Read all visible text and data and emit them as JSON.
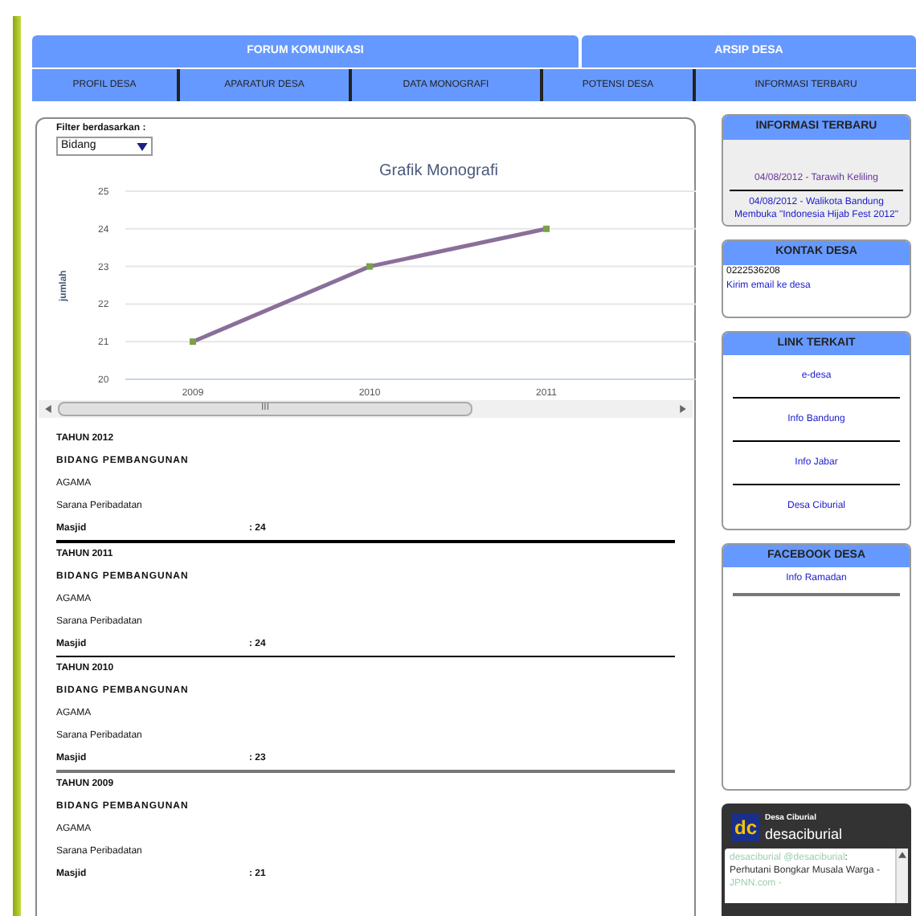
{
  "top_nav": [
    {
      "label": "FORUM KOMUNIKASI"
    },
    {
      "label": "ARSIP DESA"
    }
  ],
  "sub_nav": [
    {
      "label": "PROFIL DESA"
    },
    {
      "label": "APARATUR DESA"
    },
    {
      "label": "DATA MONOGRAFI"
    },
    {
      "label": "POTENSI DESA"
    },
    {
      "label": "INFORMASI TERBARU"
    }
  ],
  "filter": {
    "label": "Filter berdasarkan :",
    "value": "Bidang"
  },
  "chart": {
    "chart_data": {
      "type": "line",
      "title": "Grafik Monografi",
      "ylabel": "jumlah",
      "categories": [
        "2009",
        "2010",
        "2011"
      ],
      "series": [
        {
          "color": "#8a6f9a",
          "marker": "square",
          "values": [
            21,
            23,
            24
          ]
        }
      ],
      "ylim": [
        20,
        25
      ],
      "yticks": [
        20,
        21,
        22,
        23,
        24,
        25
      ],
      "grid": true
    },
    "scroll_grip": "III"
  },
  "sections": [
    {
      "year": "TAHUN 2012",
      "rows": [
        {
          "kind": "bold",
          "text": "BIDANG PEMBANGUNAN"
        },
        {
          "kind": "plain",
          "text": "AGAMA"
        },
        {
          "kind": "plain",
          "text": "Sarana Peribadatan"
        },
        {
          "kind": "value",
          "text": "Masjid",
          "value": ": 24"
        }
      ],
      "kind": "thick"
    },
    {
      "year": "TAHUN 2011",
      "rows": [
        {
          "kind": "bold",
          "text": "BIDANG PEMBANGUNAN"
        },
        {
          "kind": "plain",
          "text": "AGAMA"
        },
        {
          "kind": "plain",
          "text": "Sarana Peribadatan"
        },
        {
          "kind": "value",
          "text": "Masjid",
          "value": ": 24"
        }
      ],
      "kind": "thin"
    },
    {
      "year": "TAHUN 2010",
      "rows": [
        {
          "kind": "bold",
          "text": "BIDANG PEMBANGUNAN"
        },
        {
          "kind": "plain",
          "text": "AGAMA"
        },
        {
          "kind": "plain",
          "text": "Sarana Peribadatan"
        },
        {
          "kind": "value",
          "text": "Masjid",
          "value": ": 23"
        }
      ],
      "kind": "grey"
    },
    {
      "year": "TAHUN 2009",
      "rows": [
        {
          "kind": "bold",
          "text": "BIDANG PEMBANGUNAN"
        },
        {
          "kind": "plain",
          "text": "AGAMA"
        },
        {
          "kind": "plain",
          "text": "Sarana Peribadatan"
        },
        {
          "kind": "value",
          "text": "Masjid",
          "value": ": 21"
        }
      ],
      "kind": "last"
    }
  ],
  "sidebar": {
    "info": {
      "title": "INFORMASI TERBARU",
      "items": [
        {
          "text": "04/08/2012 - Tarawih Keliling",
          "visited": true
        },
        {
          "text": "04/08/2012 - Walikota Bandung Membuka \"Indonesia Hijab Fest 2012\"",
          "visited": false
        }
      ]
    },
    "contact": {
      "title": "KONTAK DESA",
      "phone": "0222536208",
      "email_link": "Kirim email ke desa"
    },
    "links": {
      "title": "LINK TERKAIT",
      "items": [
        "e-desa",
        "Info Bandung",
        "Info Jabar",
        "Desa Ciburial"
      ]
    },
    "facebook": {
      "title": "FACEBOOK DESA",
      "items": [
        "Info Ramadan"
      ]
    },
    "twitter": {
      "logo": "dc",
      "name": "Desa Ciburial",
      "handle": "desaciburial",
      "tweet_user": "desaciburial @desaciburial",
      "tweet_text": ": Perhutani Bongkar Musala Warga - ",
      "tweet_source": "JPNN.com -"
    }
  }
}
